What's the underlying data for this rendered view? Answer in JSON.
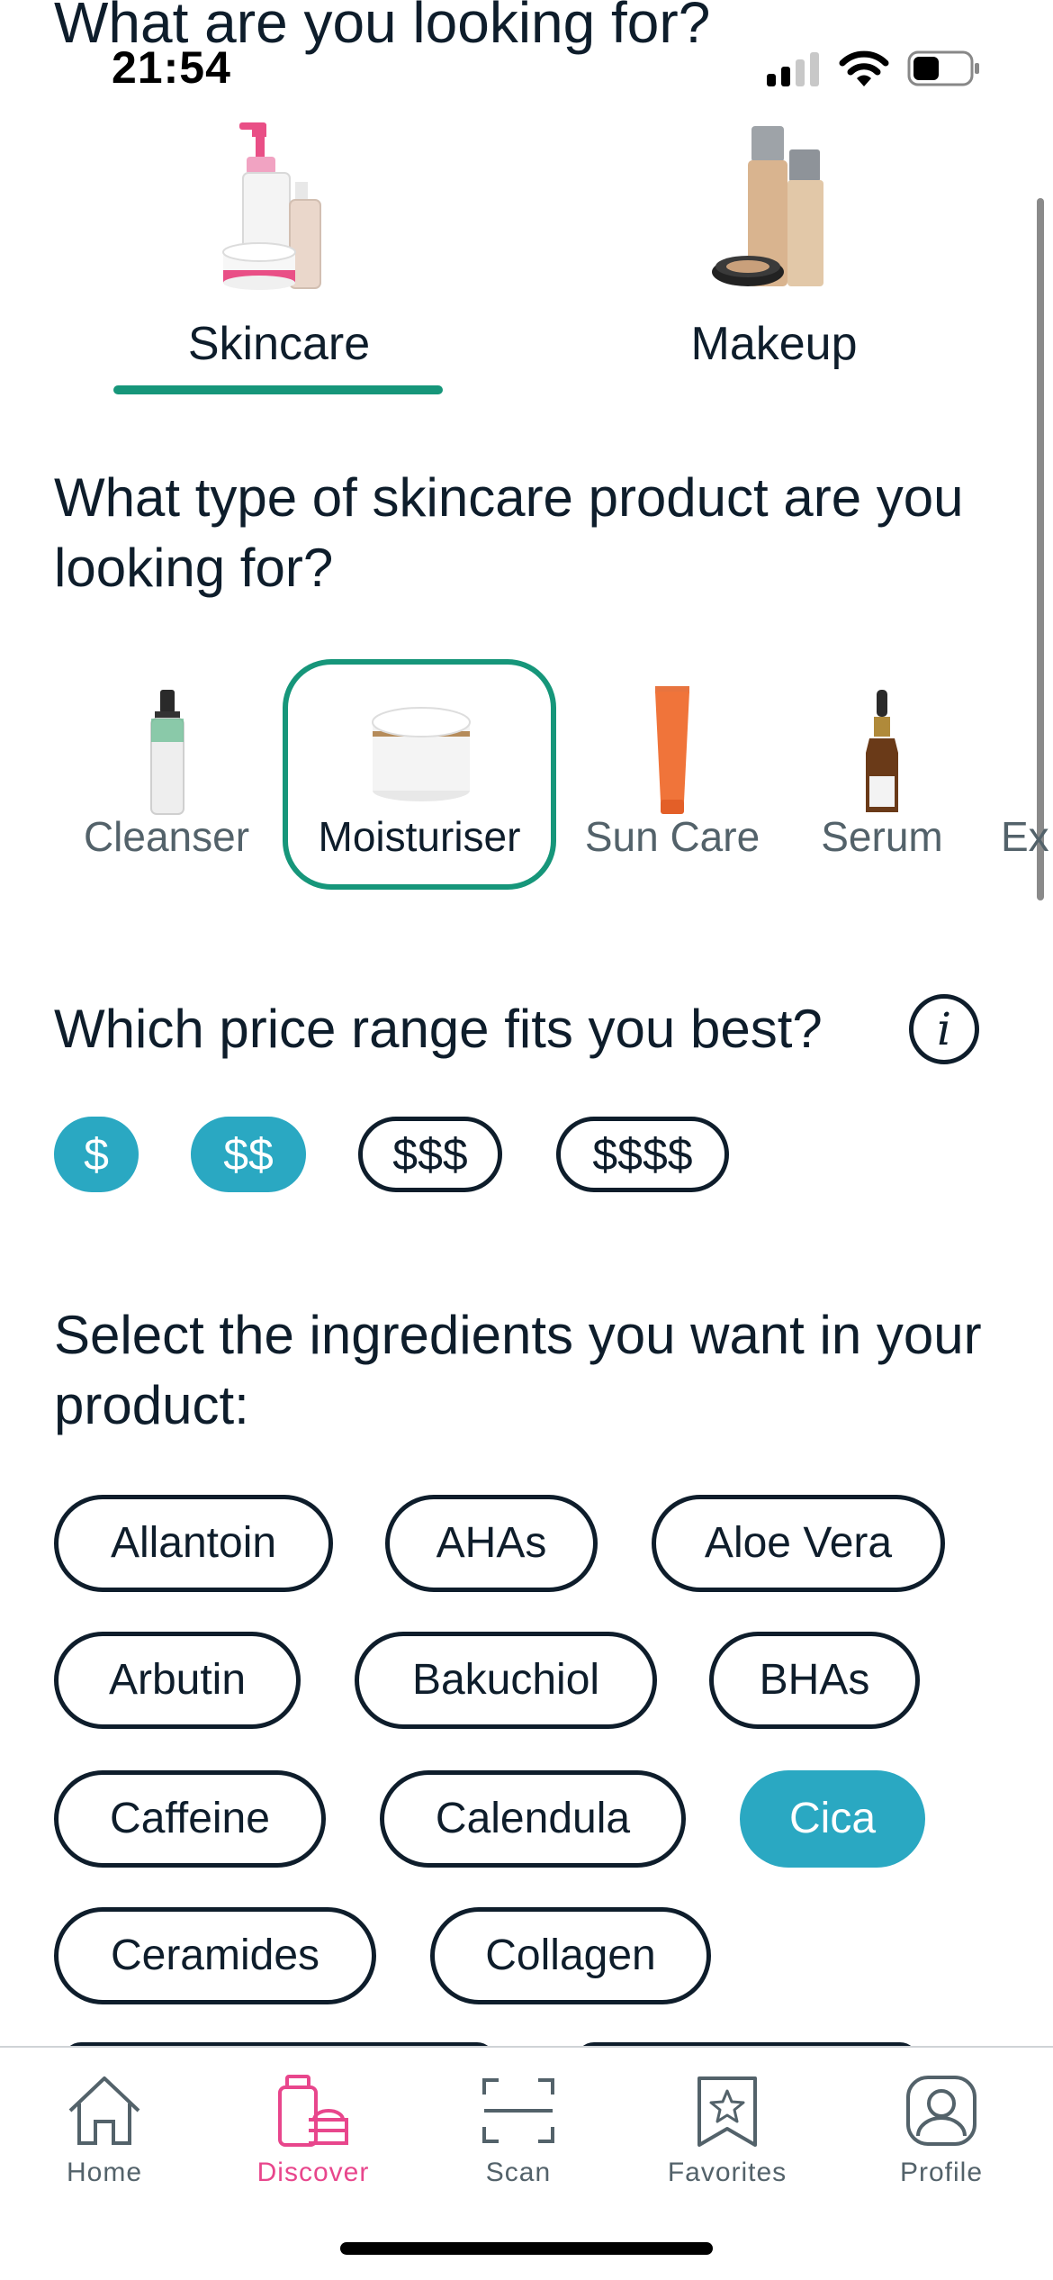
{
  "status_bar": {
    "time": "21:54"
  },
  "header": {
    "title": "What are you looking for?"
  },
  "categories": [
    {
      "label": "Skincare",
      "selected": true
    },
    {
      "label": "Makeup",
      "selected": false
    }
  ],
  "product_type": {
    "title": "What type of skincare product are you looking for?",
    "items": [
      {
        "label": "Cleanser",
        "selected": false
      },
      {
        "label": "Moisturiser",
        "selected": true
      },
      {
        "label": "Sun Care",
        "selected": false
      },
      {
        "label": "Serum",
        "selected": false
      },
      {
        "label": "Ex",
        "selected": false
      }
    ]
  },
  "price": {
    "title": "Which price range fits you best?",
    "info_icon": "info-icon",
    "options": [
      {
        "label": "$",
        "selected": true
      },
      {
        "label": "$$",
        "selected": true
      },
      {
        "label": "$$$",
        "selected": false
      },
      {
        "label": "$$$$",
        "selected": false
      }
    ]
  },
  "ingredients": {
    "title": "Select the ingredients you want in your product:",
    "items": [
      {
        "label": "Allantoin",
        "selected": false
      },
      {
        "label": "AHAs",
        "selected": false
      },
      {
        "label": "Aloe Vera",
        "selected": false
      },
      {
        "label": "Arbutin",
        "selected": false
      },
      {
        "label": "Bakuchiol",
        "selected": false
      },
      {
        "label": "BHAs",
        "selected": false
      },
      {
        "label": "Caffeine",
        "selected": false
      },
      {
        "label": "Calendula",
        "selected": false
      },
      {
        "label": "Cica",
        "selected": true
      },
      {
        "label": "Ceramides",
        "selected": false
      },
      {
        "label": "Collagen",
        "selected": false
      }
    ]
  },
  "bottom_nav": [
    {
      "label": "Home",
      "icon": "home-icon",
      "active": false
    },
    {
      "label": "Discover",
      "icon": "discover-icon",
      "active": true
    },
    {
      "label": "Scan",
      "icon": "scan-icon",
      "active": false
    },
    {
      "label": "Favorites",
      "icon": "favorites-icon",
      "active": false
    },
    {
      "label": "Profile",
      "icon": "profile-icon",
      "active": false
    }
  ],
  "colors": {
    "accent_green": "#16967a",
    "chip_selected": "#2aa8c2",
    "nav_active": "#e8468c",
    "text_dark": "#0e1d2b"
  }
}
